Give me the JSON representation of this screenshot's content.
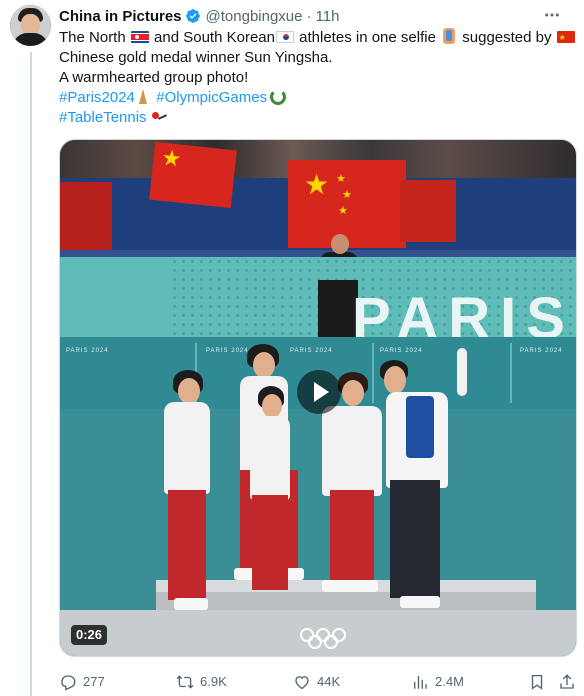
{
  "author": {
    "name": "China in Pictures",
    "handle": "@tongbingxue",
    "separator": "·",
    "time": "11h"
  },
  "icons": {
    "verified": "verified-badge-icon",
    "more": "more-icon",
    "reply": "reply-icon",
    "retweet": "retweet-icon",
    "like": "like-icon",
    "views": "views-icon",
    "bookmark": "bookmark-icon",
    "share": "share-icon"
  },
  "colors": {
    "accent": "#1d9bf0",
    "text": "#0f1419",
    "muted": "#536471"
  },
  "tweet": {
    "line1_a": "The North",
    "line1_b": "and South Korean",
    "line1_c": "athletes in one selfie",
    "line1_d": "suggested by",
    "line2": "Chinese gold medal winner Sun Yingsha.",
    "line3": "A warmhearted group photo!",
    "hashtags": [
      "#Paris2024",
      "#OlympicGames",
      "#TableTennis"
    ]
  },
  "media": {
    "duration": "0:26",
    "wall_text": "PARIS",
    "board_text": "PARIS 2024"
  },
  "actions": {
    "replies": "277",
    "retweets": "6.9K",
    "likes": "44K",
    "views": "2.4M"
  }
}
